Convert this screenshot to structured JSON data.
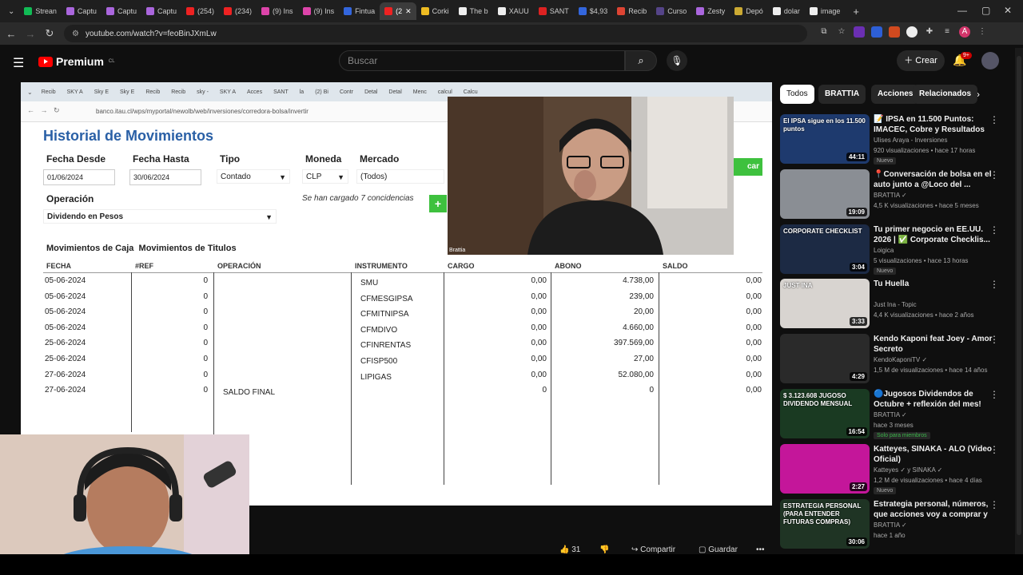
{
  "browser": {
    "tabs": [
      "Strean",
      "Captu",
      "Captu",
      "Captu",
      "(254)",
      "(234)",
      "(9) Ins",
      "(9) Ins",
      "Fintua",
      "(2",
      "Corki",
      "The b",
      "XAUU",
      "SANT",
      "$4,93",
      "Recib",
      "Curso",
      "Zesty",
      "Depó",
      "dolar",
      "image"
    ],
    "tab_colors": [
      "#1b5",
      "#a6d",
      "#a6d",
      "#a6d",
      "#e22",
      "#e22",
      "#d4a",
      "#d4a",
      "#36d",
      "#e22",
      "#eb2",
      "#eee",
      "#eee",
      "#d22",
      "#36d",
      "#d43",
      "#548",
      "#a6d",
      "#ca3",
      "#eee",
      "#eee"
    ],
    "active_tab_index": 9,
    "new_tab": "+",
    "url": "youtube.com/watch?v=feoBinJXmLw",
    "profile_letter": "A"
  },
  "youtube": {
    "brand": "Premium",
    "region": "CL",
    "search_placeholder": "Buscar",
    "create_label": "Crear",
    "notif_badge": "9+"
  },
  "video": {
    "inner_tabs": [
      "Recib",
      "SKY A",
      "Sky E",
      "Sky E",
      "Recib",
      "Recib",
      "sky -",
      "SKY A",
      "Acces",
      "SANT",
      "la",
      "(2) Bi",
      "Contr",
      "Detal",
      "Detal",
      "Menc",
      "calcul",
      "Calcu"
    ],
    "inner_url": "banco.itau.cl/wps/myportal/newolb/web/inversiones/corredora-bolsa/invertir",
    "bank": {
      "title": "Historial de Movimientos",
      "fecha_desde_label": "Fecha Desde",
      "fecha_desde": "01/06/2024",
      "fecha_hasta_label": "Fecha Hasta",
      "fecha_hasta": "30/06/2024",
      "tipo_label": "Tipo",
      "tipo": "Contado",
      "moneda_label": "Moneda",
      "moneda": "CLP",
      "mercado_label": "Mercado",
      "mercado": "(Todos)",
      "operacion_label": "Operación",
      "operacion": "Dividendo en Pesos",
      "coincidencias": "Se han cargado 7 concidencias",
      "buscar": "car",
      "tab_caja": "Movimientos de Caja",
      "tab_titulos": "Movimientos de Titulos",
      "headers": [
        "FECHA",
        "#REF",
        "OPERACIÓN",
        "INSTRUMENTO",
        "CARGO",
        "ABONO",
        "SALDO"
      ],
      "rows": [
        {
          "fecha": "05-06-2024",
          "ref": "0",
          "op": "",
          "inst": "SMU",
          "cargo": "0,00",
          "abono": "4.738,00",
          "saldo": "0,00"
        },
        {
          "fecha": "05-06-2024",
          "ref": "0",
          "op": "",
          "inst": "CFMESGIPSA",
          "cargo": "0,00",
          "abono": "239,00",
          "saldo": "0,00"
        },
        {
          "fecha": "05-06-2024",
          "ref": "0",
          "op": "",
          "inst": "CFMITNIPSA",
          "cargo": "0,00",
          "abono": "20,00",
          "saldo": "0,00"
        },
        {
          "fecha": "05-06-2024",
          "ref": "0",
          "op": "",
          "inst": "CFMDIVO",
          "cargo": "0,00",
          "abono": "4.660,00",
          "saldo": "0,00"
        },
        {
          "fecha": "25-06-2024",
          "ref": "0",
          "op": "",
          "inst": "CFINRENTAS",
          "cargo": "0,00",
          "abono": "397.569,00",
          "saldo": "0,00"
        },
        {
          "fecha": "25-06-2024",
          "ref": "0",
          "op": "",
          "inst": "CFISP500",
          "cargo": "0,00",
          "abono": "27,00",
          "saldo": "0,00"
        },
        {
          "fecha": "27-06-2024",
          "ref": "0",
          "op": "",
          "inst": "LIPIGAS",
          "cargo": "0,00",
          "abono": "52.080,00",
          "saldo": "0,00"
        },
        {
          "fecha": "27-06-2024",
          "ref": "0",
          "op": "SALDO FINAL",
          "inst": "",
          "cargo": "0",
          "abono": "0",
          "saldo": "0,00"
        }
      ]
    },
    "webcam_label": "Brattia",
    "likes": "31",
    "share_label": "Compartir",
    "save_label": "Guardar"
  },
  "sidebar": {
    "chips": [
      "Todos",
      "BRATTIA",
      "Acciones",
      "Relacionados"
    ],
    "videos": [
      {
        "title": "📝 IPSA en 11.500 Puntos: IMACEC, Cobre y Resultados ...",
        "channel": "Ulises Araya - Inversiones",
        "stats": "920 visualizaciones • hace 17 horas",
        "badge": "Nuevo",
        "duration": "44:11",
        "thumb_text": "El IPSA sigue en los 11.500 puntos",
        "thumb_color": "#1e3a6e"
      },
      {
        "title": "📍Conversación de bolsa en el auto junto a @Loco del ...",
        "channel": "BRATTIA ✓",
        "stats": "4,5 K visualizaciones • hace 5 meses",
        "badge": "",
        "duration": "19:09",
        "thumb_text": "",
        "thumb_color": "#8a8e94"
      },
      {
        "title": "Tu primer negocio en EE.UU. 2026 | ✅ Corporate Checklis...",
        "channel": "Loigica",
        "stats": "5 visualizaciones • hace 13 horas",
        "badge": "Nuevo",
        "duration": "3:04",
        "thumb_text": "CORPORATE CHECKLIST",
        "thumb_color": "#1c2a44"
      },
      {
        "title": "Tu Huella",
        "channel": "Just Ina - Topic",
        "stats": "4,4 K visualizaciones • hace 2 años",
        "badge": "",
        "duration": "3:33",
        "thumb_text": "JUST INA",
        "thumb_color": "#d8d4d0"
      },
      {
        "title": "Kendo Kaponi feat Joey - Amor Secreto",
        "channel": "KendoKaponiTV ✓",
        "stats": "1,5 M de visualizaciones • hace 14 años",
        "badge": "",
        "duration": "4:29",
        "thumb_text": "",
        "thumb_color": "#2a2a2a"
      },
      {
        "title": "🔵Jugosos Dividendos de Octubre + reflexión del mes!",
        "channel": "BRATTIA ✓",
        "stats": "hace 3 meses",
        "badge": "Solo para miembros",
        "duration": "16:54",
        "thumb_text": "$ 3.123.608 JUGOSO DIVIDENDO MENSUAL",
        "thumb_color": "#1a3a22"
      },
      {
        "title": "Katteyes, SINAKA - ALO (Video Oficial)",
        "channel": "Katteyes ✓ y SINAKA ✓",
        "stats": "1,2 M de visualizaciones • hace 4 días",
        "badge": "Nuevo",
        "duration": "2:27",
        "thumb_text": "",
        "thumb_color": "#c4169a"
      },
      {
        "title": "Estrategia personal, números, que acciones voy a comprar y ...",
        "channel": "BRATTIA ✓",
        "stats": "hace 1 año",
        "badge": "",
        "duration": "30:06",
        "thumb_text": "ESTRATEGIA PERSONAL (PARA ENTENDER FUTURAS COMPRAS)",
        "thumb_color": "#1f3424"
      }
    ]
  },
  "colors": {
    "accent_green": "#3ec13e",
    "bank_blue": "#2a60a6",
    "yt_red": "#ff0000"
  }
}
